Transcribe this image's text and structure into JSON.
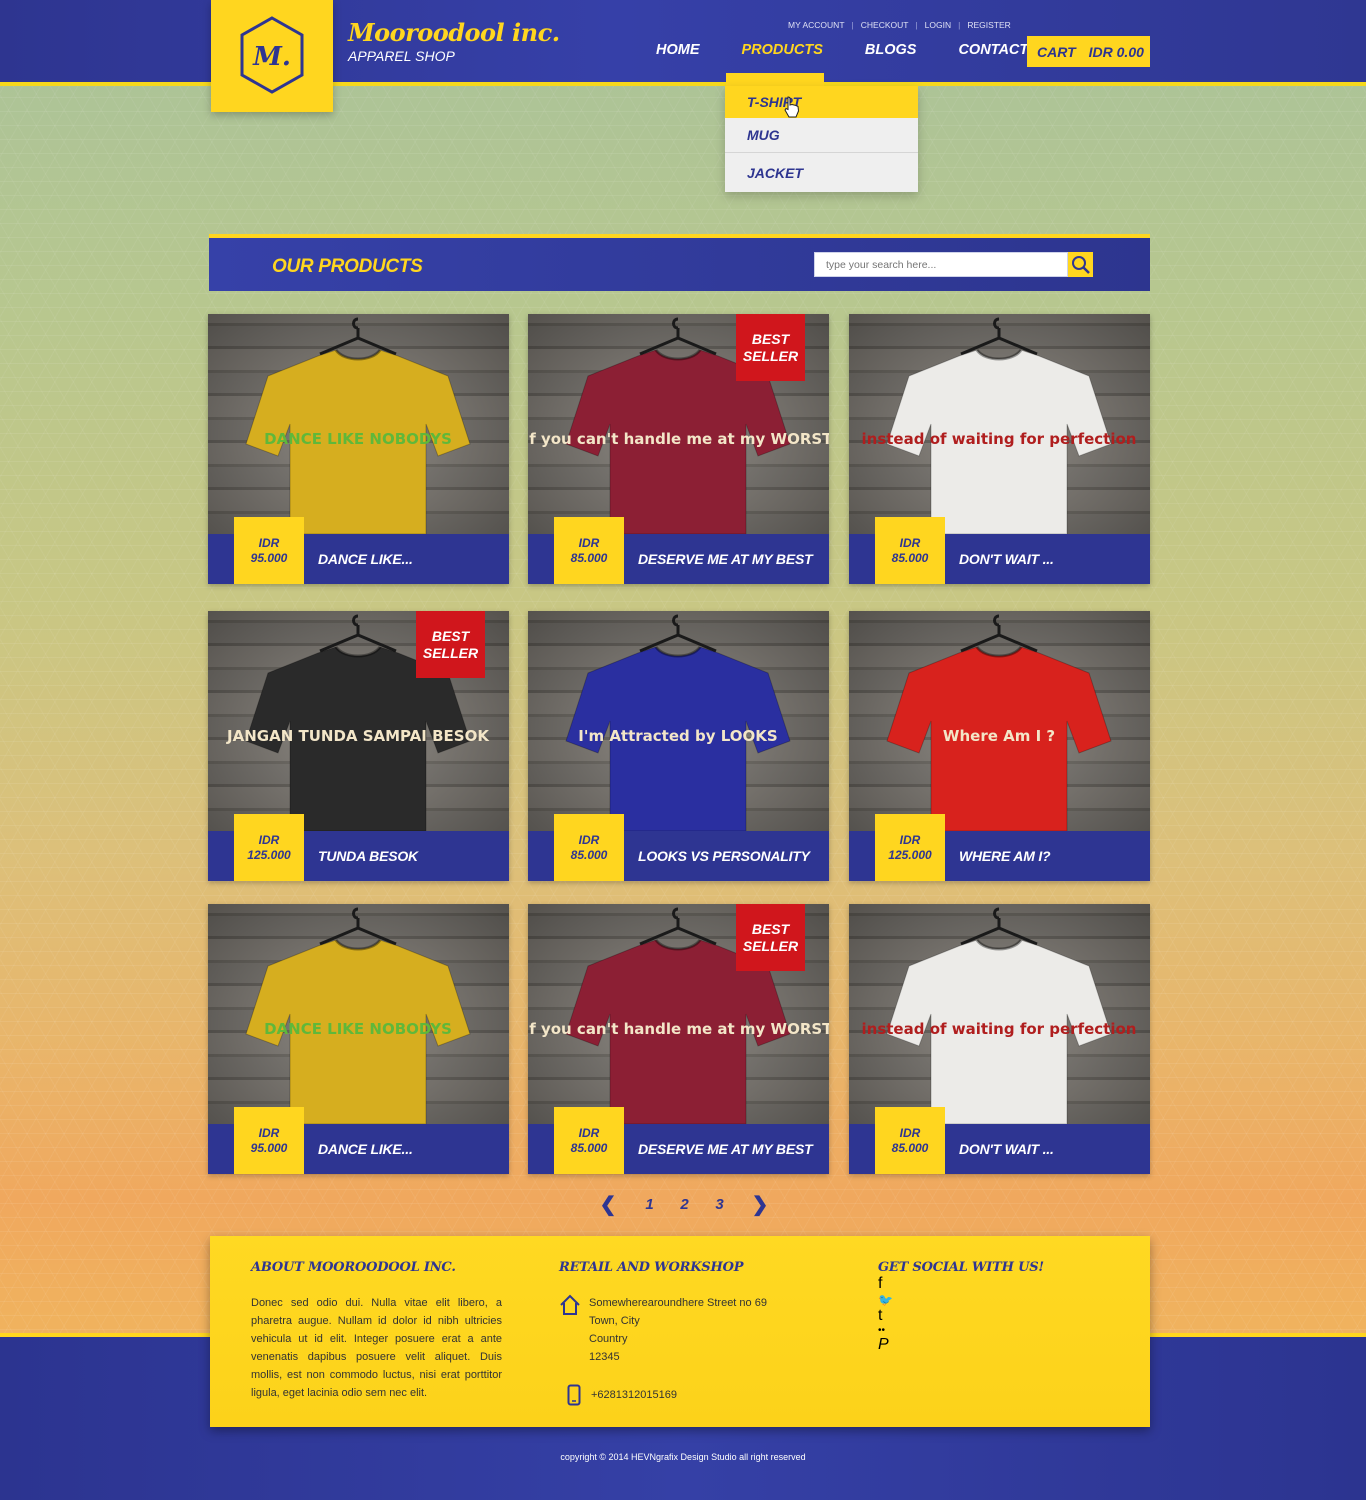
{
  "header": {
    "brand_name": "Mooroodool inc.",
    "brand_sub": "APPAREL SHOP",
    "logo_letter": "M.",
    "toplinks": [
      "MY ACCOUNT",
      "CHECKOUT",
      "LOGIN",
      "REGISTER"
    ],
    "nav": [
      "HOME",
      "PRODUCTS",
      "BLOGS",
      "CONTACT"
    ],
    "nav_active": "PRODUCTS",
    "cart_label": "CART",
    "cart_amount": "IDR 0.00"
  },
  "dropdown": {
    "items": [
      "T-SHIRT",
      "MUG",
      "JACKET"
    ],
    "highlighted": "T-SHIRT"
  },
  "products_section": {
    "title": "OUR PRODUCTS",
    "search_placeholder": "type your search here..."
  },
  "products": [
    {
      "name": "DANCE LIKE...",
      "currency": "IDR",
      "price": "95.000",
      "badge": "",
      "shirt_color": "#d6ae1f",
      "print": "DANCE LIKE NOBODYS"
    },
    {
      "name": "DESERVE ME AT MY BEST",
      "currency": "IDR",
      "price": "85.000",
      "badge": "BEST SELLER",
      "shirt_color": "#8c1f34",
      "print": "If you can't handle me at my WORST"
    },
    {
      "name": "DON'T WAIT ...",
      "currency": "IDR",
      "price": "85.000",
      "badge": "",
      "shirt_color": "#ecebe8",
      "print": "instead of waiting for perfection"
    },
    {
      "name": "TUNDA BESOK",
      "currency": "IDR",
      "price": "125.000",
      "badge": "BEST SELLER",
      "shirt_color": "#2a2a2a",
      "print": "JANGAN TUNDA SAMPAI BESOK"
    },
    {
      "name": "LOOKS VS PERSONALITY",
      "currency": "IDR",
      "price": "85.000",
      "badge": "",
      "shirt_color": "#2a2fa0",
      "print": "I'm Attracted by LOOKS"
    },
    {
      "name": "WHERE AM I?",
      "currency": "IDR",
      "price": "125.000",
      "badge": "",
      "shirt_color": "#d8221d",
      "print": "Where Am I ?"
    },
    {
      "name": "DANCE LIKE...",
      "currency": "IDR",
      "price": "95.000",
      "badge": "",
      "shirt_color": "#d6ae1f",
      "print": "DANCE LIKE NOBODYS"
    },
    {
      "name": "DESERVE ME AT MY BEST",
      "currency": "IDR",
      "price": "85.000",
      "badge": "BEST SELLER",
      "shirt_color": "#8c1f34",
      "print": "If you can't handle me at my WORST"
    },
    {
      "name": "DON'T WAIT ...",
      "currency": "IDR",
      "price": "85.000",
      "badge": "",
      "shirt_color": "#ecebe8",
      "print": "instead of waiting for perfection"
    }
  ],
  "pagination": {
    "prev": "❮",
    "next": "❯",
    "pages": [
      "1",
      "2",
      "3"
    ],
    "current": "1"
  },
  "footer": {
    "about_title": "ABOUT MOOROODOOL INC.",
    "about_text": "Donec sed odio dui. Nulla vitae elit libero, a pharetra augue. Nullam id dolor id nibh ultricies vehicula ut id elit. Integer posuere erat a ante venenatis dapibus posuere velit aliquet. Duis mollis, est non commodo luctus, nisi erat porttitor ligula, eget lacinia odio sem nec elit.",
    "retail_title": "RETAIL AND WORKSHOP",
    "address": [
      "Somewherearoundhere Street no 69",
      "Town, City",
      "Country",
      "12345"
    ],
    "phone": "+6281312015169",
    "social_title": "GET SOCIAL WITH US!",
    "social": [
      {
        "name": "facebook-icon",
        "glyph": "f"
      },
      {
        "name": "twitter-icon",
        "glyph": "🐦"
      },
      {
        "name": "tumblr-icon",
        "glyph": "t"
      },
      {
        "name": "flickr-icon",
        "glyph": "••"
      },
      {
        "name": "pinterest-icon",
        "glyph": "P"
      }
    ]
  },
  "copyright": "copyright © 2014 HEVNgrafix Design Studio all right reserved",
  "colors": {
    "brand_blue": "#2e3592",
    "brand_yellow": "#ffd61f",
    "badge_red": "#d0161c"
  }
}
